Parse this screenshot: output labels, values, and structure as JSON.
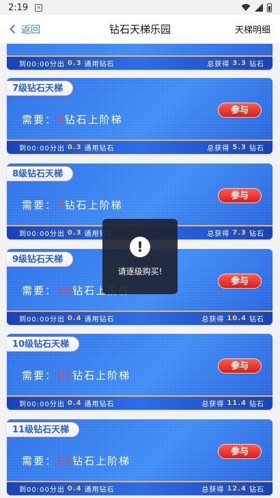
{
  "status": {
    "time": "2:19"
  },
  "nav": {
    "back_label": "返回",
    "title": "钻石天梯乐园",
    "right_label": "天梯明细"
  },
  "cards": [
    {
      "need_prefix": "需要：",
      "need_num": "",
      "need_suffix": "",
      "btn": "",
      "title": "",
      "foot_left": "到00:00分出",
      "foot_rate": "0.3",
      "foot_unit": "通用钻石",
      "foot_total_label": "总获得",
      "foot_total": "3.3",
      "foot_total_unit": "钻石"
    },
    {
      "title": "7级钻石天梯",
      "need_prefix": "需要：",
      "need_num": "5",
      "need_suffix": "钻石上阶梯",
      "btn": "参与",
      "foot_left": "到00:00分出",
      "foot_rate": "0.3",
      "foot_unit": "通用钻石",
      "foot_total_label": "总获得",
      "foot_total": "5.3",
      "foot_total_unit": "钻石"
    },
    {
      "title": "8级钻石天梯",
      "need_prefix": "需要：",
      "need_num": "7",
      "need_suffix": "钻石上阶梯",
      "btn": "参与",
      "foot_left": "到00:00分出",
      "foot_rate": "0.3",
      "foot_unit": "通用钻石",
      "foot_total_label": "总获得",
      "foot_total": "7.3",
      "foot_total_unit": "钻石"
    },
    {
      "title": "9级钻石天梯",
      "need_prefix": "需要：",
      "need_num": "10",
      "need_suffix": "钻石上阶梯",
      "btn": "参与",
      "foot_left": "到00:00分出",
      "foot_rate": "0.4",
      "foot_unit": "通用钻石",
      "foot_total_label": "总获得",
      "foot_total": "10.4",
      "foot_total_unit": "钻石"
    },
    {
      "title": "10级钻石天梯",
      "need_prefix": "需要：",
      "need_num": "11",
      "need_suffix": "钻石上阶梯",
      "btn": "参与",
      "foot_left": "到00:00分出",
      "foot_rate": "0.4",
      "foot_unit": "通用钻石",
      "foot_total_label": "总获得",
      "foot_total": "11.4",
      "foot_total_unit": "钻石"
    },
    {
      "title": "11级钻石天梯",
      "need_prefix": "需要：",
      "need_num": "12",
      "need_suffix": "钻石上阶梯",
      "btn": "参与",
      "foot_left": "到00:00分出",
      "foot_rate": "0.4",
      "foot_unit": "通用钻石",
      "foot_total_label": "总获得",
      "foot_total": "12.4",
      "foot_total_unit": "钻石"
    }
  ],
  "toast": {
    "icon": "!",
    "text": "请逐级购买!"
  }
}
